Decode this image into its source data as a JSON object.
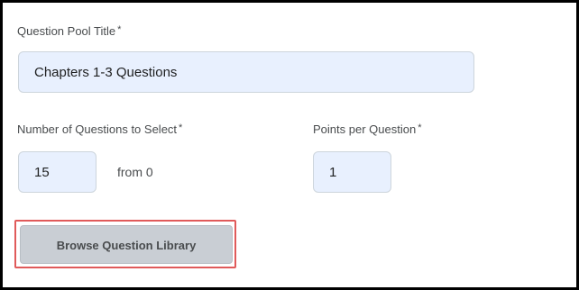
{
  "pool_title": {
    "label": "Question Pool Title",
    "required_marker": "*",
    "value": "Chapters 1-3 Questions"
  },
  "num_questions": {
    "label": "Number of Questions to Select",
    "required_marker": "*",
    "value": "15",
    "from_text": "from 0"
  },
  "points": {
    "label": "Points per Question",
    "required_marker": "*",
    "value": "1"
  },
  "browse_button": {
    "label": "Browse Question Library"
  },
  "colors": {
    "field_background": "#e8f0fe",
    "button_background": "#c9ced4",
    "highlight_border": "#e05a5a"
  }
}
